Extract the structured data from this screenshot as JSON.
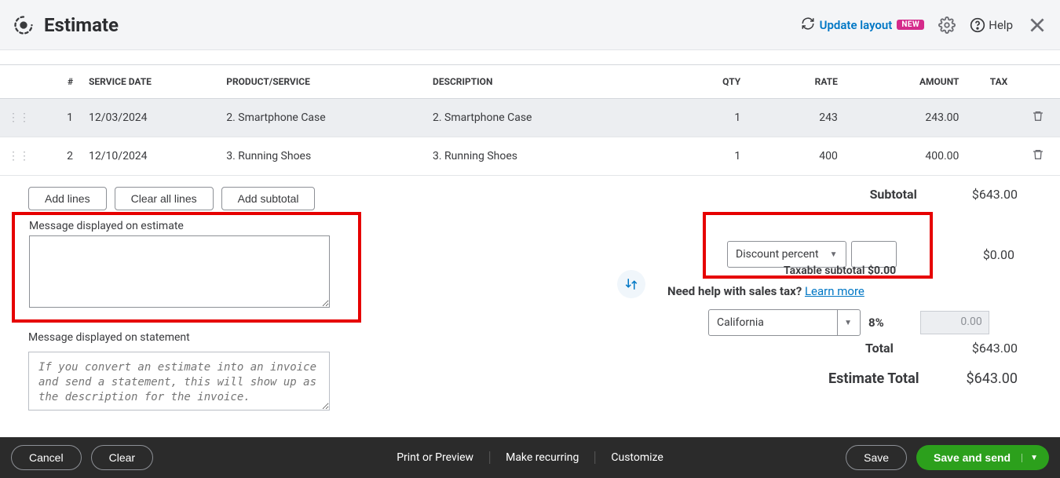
{
  "header": {
    "title": "Estimate",
    "update_layout": "Update layout",
    "new_badge": "NEW",
    "help": "Help"
  },
  "table": {
    "columns": {
      "num": "#",
      "service_date": "SERVICE DATE",
      "product": "PRODUCT/SERVICE",
      "description": "DESCRIPTION",
      "qty": "QTY",
      "rate": "RATE",
      "amount": "AMOUNT",
      "tax": "TAX"
    },
    "rows": [
      {
        "num": "1",
        "date": "12/03/2024",
        "product": "2. Smartphone Case",
        "description": "2. Smartphone Case",
        "qty": "1",
        "rate": "243",
        "amount": "243.00",
        "selected": true
      },
      {
        "num": "2",
        "date": "12/10/2024",
        "product": "3. Running Shoes",
        "description": "3. Running Shoes",
        "qty": "1",
        "rate": "400",
        "amount": "400.00",
        "selected": false
      }
    ]
  },
  "buttons": {
    "add_lines": "Add lines",
    "clear_all": "Clear all lines",
    "add_subtotal": "Add subtotal"
  },
  "messages": {
    "estimate_label": "Message displayed on estimate",
    "statement_label": "Message displayed on statement",
    "statement_placeholder": "If you convert an estimate into an invoice and send a statement, this will show up as the description for the invoice."
  },
  "discount": {
    "type": "Discount percent",
    "amount": "$0.00",
    "taxable_label": "Taxable subtotal",
    "taxable_value": "$0.00"
  },
  "tax": {
    "help_text": "Need help with sales tax?",
    "learn_more": "Learn more",
    "jurisdiction": "California",
    "rate": "8%",
    "amount": "0.00"
  },
  "totals": {
    "subtotal_label": "Subtotal",
    "subtotal_value": "$643.00",
    "total_label": "Total",
    "total_value": "$643.00",
    "estimate_total_label": "Estimate Total",
    "estimate_total_value": "$643.00"
  },
  "footer": {
    "cancel": "Cancel",
    "clear": "Clear",
    "print": "Print or Preview",
    "recurring": "Make recurring",
    "customize": "Customize",
    "save": "Save",
    "save_send": "Save and send"
  }
}
